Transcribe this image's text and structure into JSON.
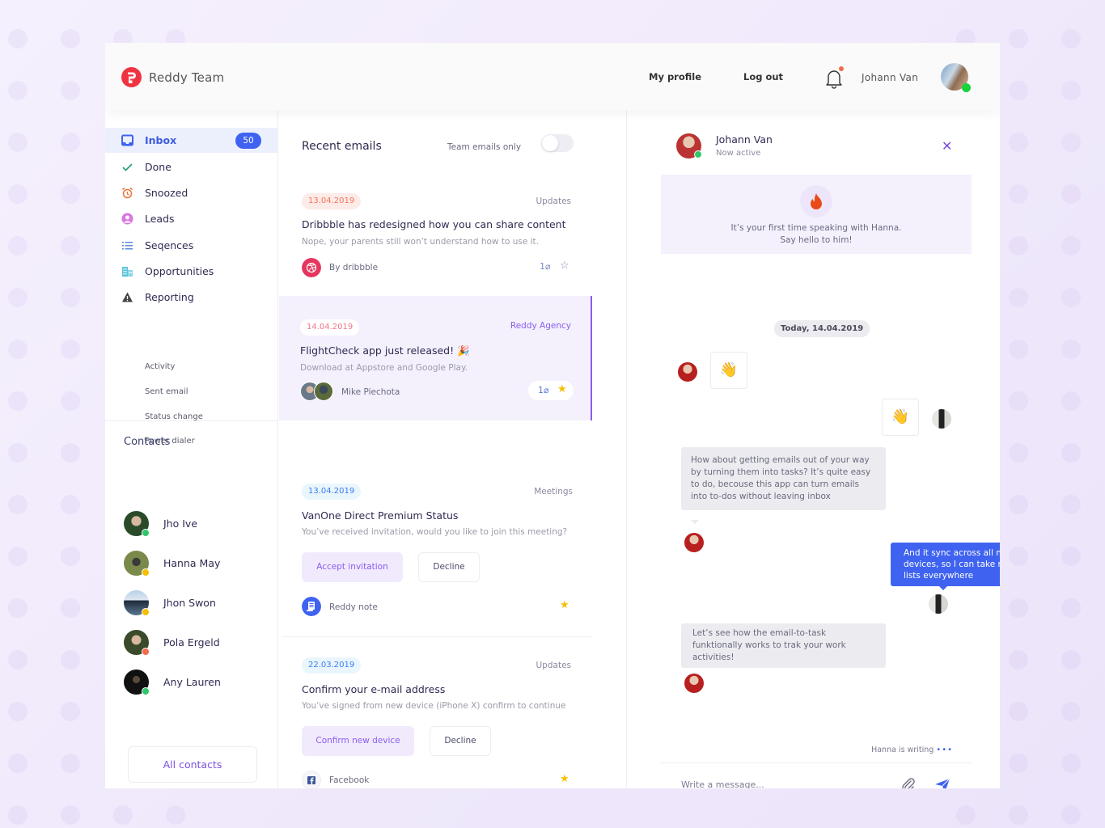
{
  "header": {
    "brand": "Reddy Team",
    "logo_icon": "reddy-logo-icon",
    "nav": [
      "My profile",
      "Log out"
    ],
    "notification_icon": "bell-icon",
    "user_name": "Johann Van",
    "user_status": "online"
  },
  "sidebar": {
    "items": [
      {
        "label": "Inbox",
        "icon": "inbox-icon",
        "badge": "50",
        "active": true
      },
      {
        "label": "Done",
        "icon": "check-icon"
      },
      {
        "label": "Snoozed",
        "icon": "alarm-clock-icon"
      },
      {
        "label": "Leads",
        "icon": "user-circle-icon"
      },
      {
        "label": "Seqences",
        "icon": "list-icon"
      },
      {
        "label": "Opportunities",
        "icon": "building-icon"
      },
      {
        "label": "Reporting",
        "icon": "warning-triangle-icon"
      }
    ],
    "sub_items": [
      "Activity",
      "Sent email",
      "Status change",
      "Power dialer"
    ],
    "contacts_title": "Contacts",
    "contacts": [
      {
        "name": "Jho Ive",
        "status": "online"
      },
      {
        "name": "Hanna May",
        "status": "away"
      },
      {
        "name": "Jhon Swon",
        "status": "away"
      },
      {
        "name": "Pola Ergeld",
        "status": "busy"
      },
      {
        "name": "Any Lauren",
        "status": "online"
      }
    ],
    "all_contacts_label": "All contacts"
  },
  "emails": {
    "title": "Recent emails",
    "team_only_label": "Team emails only",
    "team_only_enabled": false,
    "items": [
      {
        "date": "13.04.2019",
        "category": "Updates",
        "subject": "Dribbble has redesigned how you can share content",
        "preview": "Nope, your parents still won’t understand how to use it.",
        "source": "By dribbble",
        "attachments": "1",
        "starred": false
      },
      {
        "date": "14.04.2019",
        "category": "Reddy Agency",
        "subject": "FlightCheck app just released! 🎉",
        "preview": "Download at Appstore and Google Play.",
        "source": "Mike Piechota",
        "attachments": "1",
        "starred": true,
        "selected": true
      },
      {
        "date": "13.04.2019",
        "category": "Meetings",
        "subject": "VanOne Direct Premium Status",
        "preview": "You’ve received invitation, would you like to join this meeting?",
        "primary_action": "Accept invitation",
        "secondary_action": "Decline",
        "source": "Reddy note",
        "starred": true
      },
      {
        "date": "22.03.2019",
        "category": "Updates",
        "subject": "Confirm your e-mail address",
        "preview": "You’ve signed from new device (iPhone X) confirm to continue",
        "primary_action": "Confirm new device",
        "secondary_action": "Decline",
        "source": "Facebook",
        "starred": true
      }
    ]
  },
  "chat": {
    "name": "Johann Van",
    "status_text": "Now active",
    "intro_line1": "It’s your first time speaking with Hanna.",
    "intro_line2": "Say hello to him!",
    "day_label": "Today, 14.04.2019",
    "messages": [
      {
        "from": "Johann",
        "text": "👋"
      },
      {
        "from": "Hanna",
        "text": "👋"
      },
      {
        "from": "Johann",
        "text": "How about getting emails out of your way by turning them into tasks? It’s quite easy to do, becouse this app can turn emails into to-dos without leaving inbox"
      },
      {
        "from": "Hanna",
        "text": "And it sync across all my devices, so I can take my to-dos lists everywhere"
      },
      {
        "from": "Johann",
        "text": "Let’s see how the email-to-task funktionally works to trak your work activities!"
      }
    ],
    "typing_indicator": "Hanna is writing",
    "typing_dots": "•••",
    "input_placeholder": "Write a message...",
    "input_value": ""
  },
  "colors": {
    "accent_blue": "#3f63f0",
    "accent_purple": "#8a5cf0",
    "brand_red": "#ef3340",
    "status_online": "#2ec66a",
    "status_away": "#f5c000",
    "status_busy": "#f26b4a",
    "star": "#f5c000"
  }
}
